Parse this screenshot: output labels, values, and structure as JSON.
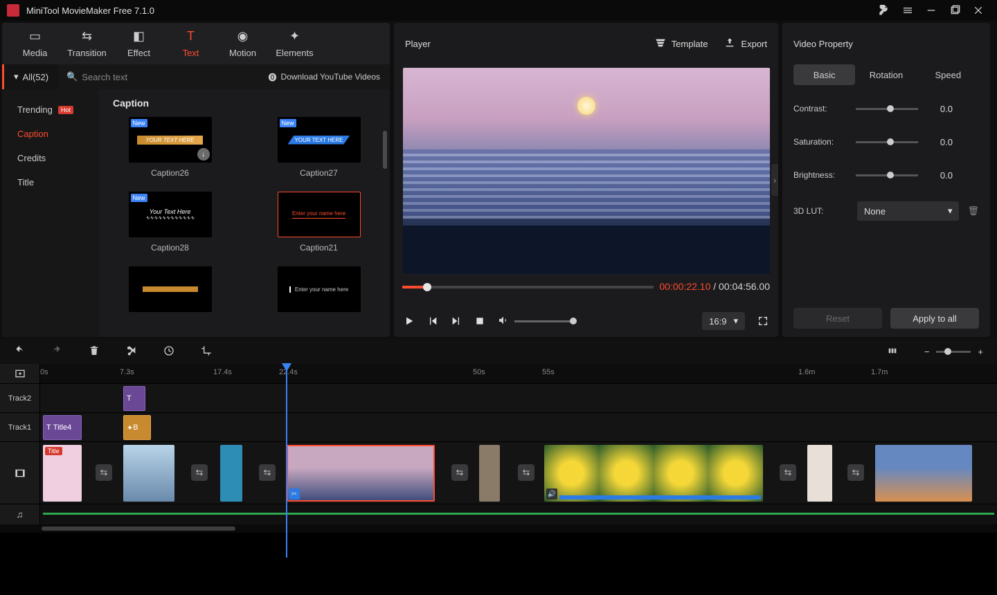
{
  "app": {
    "title": "MiniTool MovieMaker Free 7.1.0"
  },
  "library": {
    "tabs": {
      "media": "Media",
      "transition": "Transition",
      "effect": "Effect",
      "text": "Text",
      "motion": "Motion",
      "elements": "Elements"
    },
    "all": "All(52)",
    "searchPlaceholder": "Search text",
    "download": "Download YouTube Videos",
    "cats": {
      "trending": "Trending",
      "hot": "Hot",
      "caption": "Caption",
      "credits": "Credits",
      "title": "Title"
    },
    "section": "Caption",
    "thumbs": {
      "c26": "Caption26",
      "c27": "Caption27",
      "c28": "Caption28",
      "c21": "Caption21",
      "new": "New",
      "placeholder1": "YOUR TEXT HERE",
      "placeholder2": "Your Text Here",
      "placeholder3": "Enter your name here"
    }
  },
  "player": {
    "label": "Player",
    "template": "Template",
    "export": "Export",
    "cur": "00:00:22.10",
    "sep": "/",
    "total": "00:04:56.00",
    "ratio": "16:9"
  },
  "prop": {
    "title": "Video Property",
    "tabs": {
      "basic": "Basic",
      "rotation": "Rotation",
      "speed": "Speed"
    },
    "contrast": "Contrast:",
    "saturation": "Saturation:",
    "brightness": "Brightness:",
    "v0": "0.0",
    "lut": "3D LUT:",
    "lutval": "None",
    "reset": "Reset",
    "apply": "Apply to all"
  },
  "timeline": {
    "ticks": {
      "t0": "0s",
      "t1": "7.3s",
      "t2": "17.4s",
      "t3": "22.4s",
      "t4": "50s",
      "t5": "55s",
      "t6": "1.6m",
      "t7": "1.7m"
    },
    "track2": "Track2",
    "track1": "Track1",
    "title4": "Title4",
    "title": "Title"
  }
}
